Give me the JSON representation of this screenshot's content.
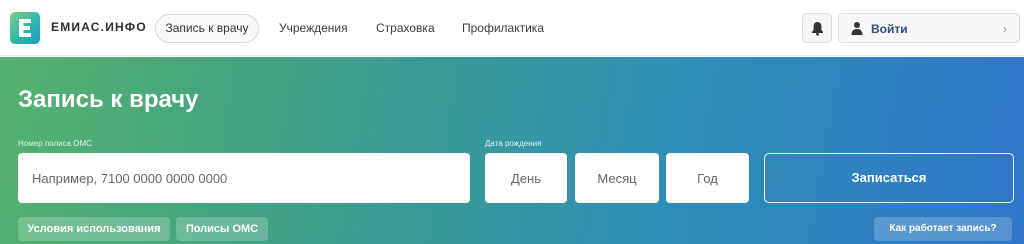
{
  "brand": {
    "logo_letter": "E",
    "name": "ЕМИАС.ИНФО"
  },
  "nav": {
    "active": "Запись к врачу",
    "items": [
      "Учреждения",
      "Страховка",
      "Профилактика"
    ]
  },
  "header_actions": {
    "login_label": "Войти",
    "chevron": "›"
  },
  "hero": {
    "title": "Запись к врачу",
    "policy_label": "Номер полиса ОМС",
    "policy_placeholder": "Например, 7100 0000 0000 0000",
    "dob_label": "Дата рождения",
    "day_placeholder": "День",
    "month_placeholder": "Месяц",
    "year_placeholder": "Год",
    "submit_label": "Записаться",
    "links": [
      "Условия использования",
      "Полисы ОМС"
    ],
    "how_label": "Как работает запись?"
  },
  "icons": [
    "logo-e-icon",
    "bell-icon",
    "user-icon",
    "chevron-right-icon"
  ],
  "colors": {
    "accent_blue": "#2f76c9",
    "accent_green": "#55b26f",
    "login_text": "#2e4e7e"
  }
}
